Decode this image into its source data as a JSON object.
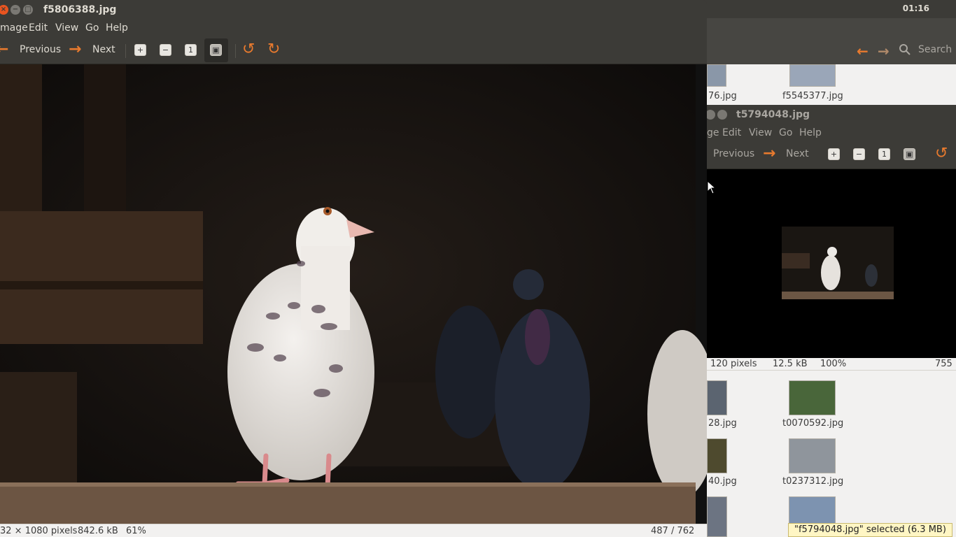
{
  "panel": {
    "clock": "01:16"
  },
  "background_browser": {
    "nav": {
      "back_icon": "arrow-left-icon",
      "forward_icon": "arrow-right-icon",
      "search_label": "Search"
    },
    "files": [
      {
        "name": "76.jpg"
      },
      {
        "name": "f5545377.jpg"
      },
      {
        "name": "28.jpg"
      },
      {
        "name": "t0070592.jpg"
      },
      {
        "name": "40.jpg"
      },
      {
        "name": "t0237312.jpg"
      }
    ],
    "tooltip": "\"f5794048.jpg\" selected (6.3 MB)"
  },
  "main_window": {
    "title": "f5806388.jpg",
    "menu": [
      "mage",
      "Edit",
      "View",
      "Go",
      "Help"
    ],
    "toolbar": {
      "previous_label": "Previous",
      "next_label": "Next",
      "zoom_in_icon": "zoom-in-icon",
      "zoom_out_icon": "zoom-out-icon",
      "normal_size_icon": "normal-size-icon",
      "best_fit_icon": "best-fit-icon",
      "rotate_left_icon": "rotate-left-icon",
      "rotate_right_icon": "rotate-right-icon"
    },
    "status": {
      "dimensions": "32 × 1080 pixels",
      "size": "842.6 kB",
      "zoom": "61%",
      "position": "487 / 762"
    }
  },
  "second_window": {
    "title": "t5794048.jpg",
    "menu": [
      "ge",
      "Edit",
      "View",
      "Go",
      "Help"
    ],
    "toolbar": {
      "previous_label": "Previous",
      "next_label": "Next"
    },
    "status": {
      "dimensions": "120 pixels",
      "size": "12.5 kB",
      "zoom": "100%",
      "position": "755"
    }
  },
  "colors": {
    "accent_orange": "#e87a2e",
    "titlebar": "#3c3b37",
    "close_button": "#e95420"
  }
}
